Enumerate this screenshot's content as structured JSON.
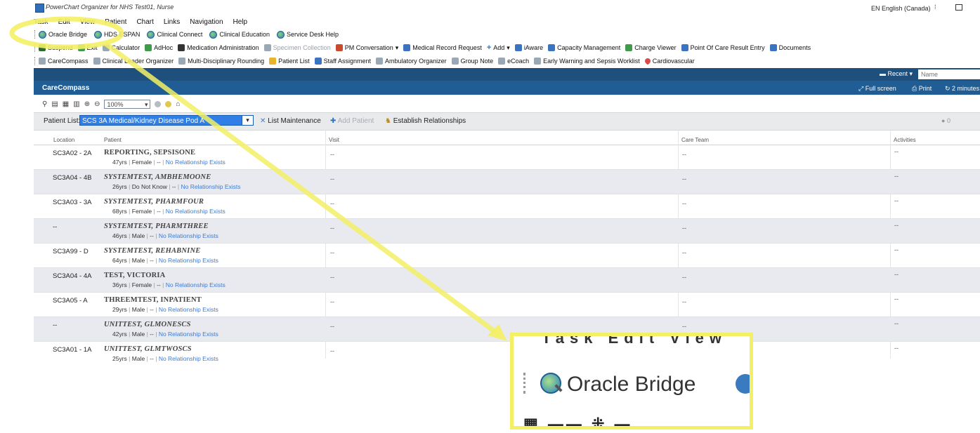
{
  "window": {
    "title": "PowerChart Organizer for NHS Test01, Nurse",
    "language": "EN English (Canada)"
  },
  "menu": [
    "Task",
    "Edit",
    "View",
    "Patient",
    "Chart",
    "Links",
    "Navigation",
    "Help"
  ],
  "toolbar1": [
    "Oracle Bridge",
    "HDS ESPAN",
    "Clinical Connect",
    "Clinical Education",
    "Service Desk Help"
  ],
  "toolbar2": [
    "Suspend",
    "Exit",
    "Calculator",
    "AdHoc",
    "Medication Administration",
    "Specimen Collection",
    "PM Conversation",
    "Medical Record Request",
    "Add",
    "iAware",
    "Capacity Management",
    "Charge Viewer",
    "Point Of Care Result Entry",
    "Documents"
  ],
  "toolbar3": [
    "CareCompass",
    "Clinical Leader Organizer",
    "Multi-Disciplinary Rounding",
    "Patient List",
    "Staff Assignment",
    "Ambulatory Organizer",
    "Group Note",
    "eCoach",
    "Early Warning and Sepsis Worklist",
    "Cardiovascular"
  ],
  "header": {
    "recent": "Recent",
    "name_placeholder": "Name",
    "section_title": "CareCompass",
    "full_screen": "Full screen",
    "print": "Print",
    "refresh": "2 minutes"
  },
  "zoom_level": "100%",
  "patient_list": {
    "label": "Patient List:",
    "selected": "SCS 3A Medical/Kidney Disease Pod A",
    "list_maintenance": "List Maintenance",
    "add_patient": "Add Patient",
    "establish_relationships": "Establish Relationships",
    "count": "0"
  },
  "columns": [
    "Location",
    "Patient",
    "Visit",
    "Care Team",
    "Activities"
  ],
  "rows": [
    {
      "location": "SC3A02 - 2A",
      "name": "REPORTING, SEPSISONE",
      "age": "47yrs",
      "sex": "Female",
      "dash": "--",
      "relationship": "No Relationship Exists",
      "visit": "--",
      "care": "--",
      "activities": "--"
    },
    {
      "location": "SC3A04 - 4B",
      "name": "SYSTEMTEST, AMBHEMOONE",
      "age": "26yrs",
      "sex": "Do Not Know",
      "dash": "--",
      "relationship": "No Relationship Exists",
      "visit": "--",
      "care": "--",
      "activities": "--"
    },
    {
      "location": "SC3A03 - 3A",
      "name": "SYSTEMTEST, PHARMFOUR",
      "age": "68yrs",
      "sex": "Female",
      "dash": "--",
      "relationship": "No Relationship Exists",
      "visit": "--",
      "care": "--",
      "activities": "--"
    },
    {
      "location": "--",
      "name": "SYSTEMTEST, PHARMTHREE",
      "age": "46yrs",
      "sex": "Male",
      "dash": "--",
      "relationship": "No Relationship Exists",
      "visit": "--",
      "care": "--",
      "activities": "--"
    },
    {
      "location": "SC3A99 - D",
      "name": "SYSTEMTEST, REHABNINE",
      "age": "64yrs",
      "sex": "Male",
      "dash": "--",
      "relationship": "No Relationship Exists",
      "visit": "--",
      "care": "--",
      "activities": "--"
    },
    {
      "location": "SC3A04 - 4A",
      "name": "TEST, VICTORIA",
      "age": "36yrs",
      "sex": "Female",
      "dash": "--",
      "relationship": "No Relationship Exists",
      "visit": "--",
      "care": "--",
      "activities": "--"
    },
    {
      "location": "SC3A05 - A",
      "name": "THREEMTEST, INPATIENT",
      "age": "29yrs",
      "sex": "Male",
      "dash": "--",
      "relationship": "No Relationship Exists",
      "visit": "--",
      "care": "--",
      "activities": "--"
    },
    {
      "location": "--",
      "name": "UNITTEST, GLMONESCS",
      "age": "42yrs",
      "sex": "Male",
      "dash": "--",
      "relationship": "No Relationship Exists",
      "visit": "--",
      "care": "--",
      "activities": "--"
    },
    {
      "location": "SC3A01 - 1A",
      "name": "UNITTEST, GLMTWOSCS",
      "age": "25yrs",
      "sex": "Male",
      "dash": "--",
      "relationship": "No Relationship Exists",
      "visit": "--",
      "care": "",
      "activities": "--"
    }
  ],
  "callout": {
    "label": "Oracle Bridge",
    "top_text": "Task  Edit  View",
    "color": "#f3f066"
  }
}
